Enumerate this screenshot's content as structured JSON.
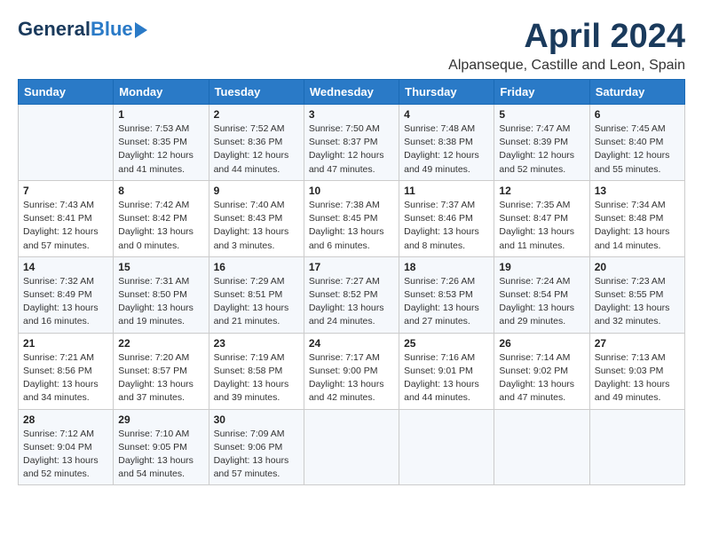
{
  "logo": {
    "general": "General",
    "blue": "Blue"
  },
  "title": "April 2024",
  "subtitle": "Alpanseque, Castille and Leon, Spain",
  "headers": [
    "Sunday",
    "Monday",
    "Tuesday",
    "Wednesday",
    "Thursday",
    "Friday",
    "Saturday"
  ],
  "weeks": [
    [
      {
        "day": "",
        "sunrise": "",
        "sunset": "",
        "daylight": ""
      },
      {
        "day": "1",
        "sunrise": "Sunrise: 7:53 AM",
        "sunset": "Sunset: 8:35 PM",
        "daylight": "Daylight: 12 hours and 41 minutes."
      },
      {
        "day": "2",
        "sunrise": "Sunrise: 7:52 AM",
        "sunset": "Sunset: 8:36 PM",
        "daylight": "Daylight: 12 hours and 44 minutes."
      },
      {
        "day": "3",
        "sunrise": "Sunrise: 7:50 AM",
        "sunset": "Sunset: 8:37 PM",
        "daylight": "Daylight: 12 hours and 47 minutes."
      },
      {
        "day": "4",
        "sunrise": "Sunrise: 7:48 AM",
        "sunset": "Sunset: 8:38 PM",
        "daylight": "Daylight: 12 hours and 49 minutes."
      },
      {
        "day": "5",
        "sunrise": "Sunrise: 7:47 AM",
        "sunset": "Sunset: 8:39 PM",
        "daylight": "Daylight: 12 hours and 52 minutes."
      },
      {
        "day": "6",
        "sunrise": "Sunrise: 7:45 AM",
        "sunset": "Sunset: 8:40 PM",
        "daylight": "Daylight: 12 hours and 55 minutes."
      }
    ],
    [
      {
        "day": "7",
        "sunrise": "Sunrise: 7:43 AM",
        "sunset": "Sunset: 8:41 PM",
        "daylight": "Daylight: 12 hours and 57 minutes."
      },
      {
        "day": "8",
        "sunrise": "Sunrise: 7:42 AM",
        "sunset": "Sunset: 8:42 PM",
        "daylight": "Daylight: 13 hours and 0 minutes."
      },
      {
        "day": "9",
        "sunrise": "Sunrise: 7:40 AM",
        "sunset": "Sunset: 8:43 PM",
        "daylight": "Daylight: 13 hours and 3 minutes."
      },
      {
        "day": "10",
        "sunrise": "Sunrise: 7:38 AM",
        "sunset": "Sunset: 8:45 PM",
        "daylight": "Daylight: 13 hours and 6 minutes."
      },
      {
        "day": "11",
        "sunrise": "Sunrise: 7:37 AM",
        "sunset": "Sunset: 8:46 PM",
        "daylight": "Daylight: 13 hours and 8 minutes."
      },
      {
        "day": "12",
        "sunrise": "Sunrise: 7:35 AM",
        "sunset": "Sunset: 8:47 PM",
        "daylight": "Daylight: 13 hours and 11 minutes."
      },
      {
        "day": "13",
        "sunrise": "Sunrise: 7:34 AM",
        "sunset": "Sunset: 8:48 PM",
        "daylight": "Daylight: 13 hours and 14 minutes."
      }
    ],
    [
      {
        "day": "14",
        "sunrise": "Sunrise: 7:32 AM",
        "sunset": "Sunset: 8:49 PM",
        "daylight": "Daylight: 13 hours and 16 minutes."
      },
      {
        "day": "15",
        "sunrise": "Sunrise: 7:31 AM",
        "sunset": "Sunset: 8:50 PM",
        "daylight": "Daylight: 13 hours and 19 minutes."
      },
      {
        "day": "16",
        "sunrise": "Sunrise: 7:29 AM",
        "sunset": "Sunset: 8:51 PM",
        "daylight": "Daylight: 13 hours and 21 minutes."
      },
      {
        "day": "17",
        "sunrise": "Sunrise: 7:27 AM",
        "sunset": "Sunset: 8:52 PM",
        "daylight": "Daylight: 13 hours and 24 minutes."
      },
      {
        "day": "18",
        "sunrise": "Sunrise: 7:26 AM",
        "sunset": "Sunset: 8:53 PM",
        "daylight": "Daylight: 13 hours and 27 minutes."
      },
      {
        "day": "19",
        "sunrise": "Sunrise: 7:24 AM",
        "sunset": "Sunset: 8:54 PM",
        "daylight": "Daylight: 13 hours and 29 minutes."
      },
      {
        "day": "20",
        "sunrise": "Sunrise: 7:23 AM",
        "sunset": "Sunset: 8:55 PM",
        "daylight": "Daylight: 13 hours and 32 minutes."
      }
    ],
    [
      {
        "day": "21",
        "sunrise": "Sunrise: 7:21 AM",
        "sunset": "Sunset: 8:56 PM",
        "daylight": "Daylight: 13 hours and 34 minutes."
      },
      {
        "day": "22",
        "sunrise": "Sunrise: 7:20 AM",
        "sunset": "Sunset: 8:57 PM",
        "daylight": "Daylight: 13 hours and 37 minutes."
      },
      {
        "day": "23",
        "sunrise": "Sunrise: 7:19 AM",
        "sunset": "Sunset: 8:58 PM",
        "daylight": "Daylight: 13 hours and 39 minutes."
      },
      {
        "day": "24",
        "sunrise": "Sunrise: 7:17 AM",
        "sunset": "Sunset: 9:00 PM",
        "daylight": "Daylight: 13 hours and 42 minutes."
      },
      {
        "day": "25",
        "sunrise": "Sunrise: 7:16 AM",
        "sunset": "Sunset: 9:01 PM",
        "daylight": "Daylight: 13 hours and 44 minutes."
      },
      {
        "day": "26",
        "sunrise": "Sunrise: 7:14 AM",
        "sunset": "Sunset: 9:02 PM",
        "daylight": "Daylight: 13 hours and 47 minutes."
      },
      {
        "day": "27",
        "sunrise": "Sunrise: 7:13 AM",
        "sunset": "Sunset: 9:03 PM",
        "daylight": "Daylight: 13 hours and 49 minutes."
      }
    ],
    [
      {
        "day": "28",
        "sunrise": "Sunrise: 7:12 AM",
        "sunset": "Sunset: 9:04 PM",
        "daylight": "Daylight: 13 hours and 52 minutes."
      },
      {
        "day": "29",
        "sunrise": "Sunrise: 7:10 AM",
        "sunset": "Sunset: 9:05 PM",
        "daylight": "Daylight: 13 hours and 54 minutes."
      },
      {
        "day": "30",
        "sunrise": "Sunrise: 7:09 AM",
        "sunset": "Sunset: 9:06 PM",
        "daylight": "Daylight: 13 hours and 57 minutes."
      },
      {
        "day": "",
        "sunrise": "",
        "sunset": "",
        "daylight": ""
      },
      {
        "day": "",
        "sunrise": "",
        "sunset": "",
        "daylight": ""
      },
      {
        "day": "",
        "sunrise": "",
        "sunset": "",
        "daylight": ""
      },
      {
        "day": "",
        "sunrise": "",
        "sunset": "",
        "daylight": ""
      }
    ]
  ]
}
